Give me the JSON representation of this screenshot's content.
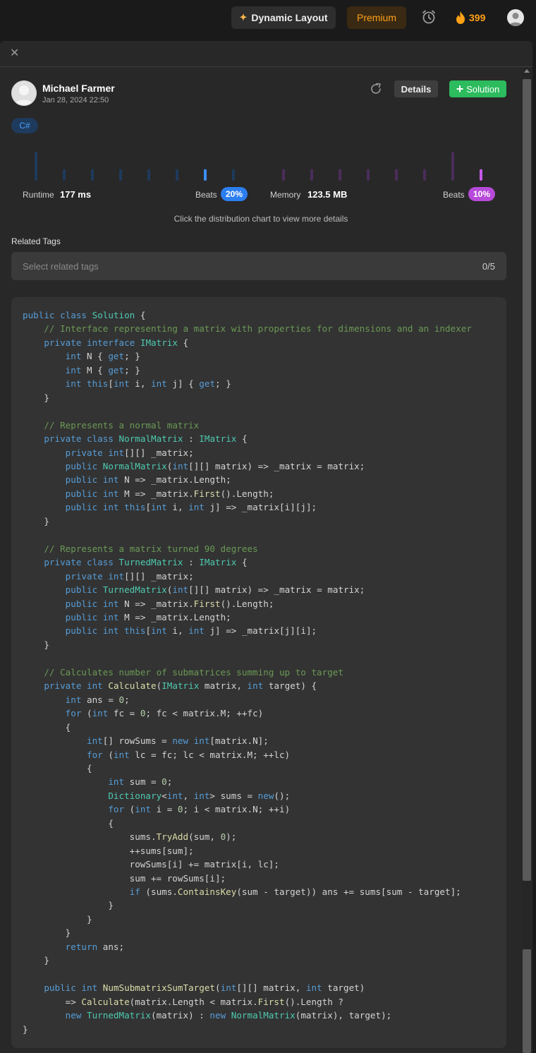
{
  "topbar": {
    "dynamic_layout_label": "Dynamic Layout",
    "premium_label": "Premium",
    "streak_count": "399",
    "icons": [
      "sparkle-icon",
      "alarm-clock-icon",
      "fire-icon",
      "user-avatar-icon"
    ]
  },
  "submission": {
    "author": "Michael Farmer",
    "date": "Jan 28, 2024 22:50",
    "details_label": "Details",
    "solution_label": "Solution",
    "language": "C#"
  },
  "stats": {
    "runtime_label": "Runtime",
    "runtime_value": "177 ms",
    "runtime_beats_label": "Beats",
    "runtime_beats": "20%",
    "memory_label": "Memory",
    "memory_value": "123.5 MB",
    "memory_beats_label": "Beats",
    "memory_beats": "10%",
    "hint": "Click the distribution chart to view more details",
    "runtime_distribution": [
      4.5,
      1.8,
      1.8,
      1.8,
      1.8,
      1.8,
      1.8,
      1.8
    ],
    "runtime_highlight_index": 6,
    "memory_distribution": [
      1.8,
      1.8,
      1.8,
      1.8,
      1.8,
      1.8,
      4.5,
      1.8
    ],
    "memory_highlight_index": 7,
    "colors": {
      "runtime_bar": "#1e3a5c",
      "runtime_active": "#3b8ef5",
      "memory_bar": "#4a2d5a",
      "memory_active": "#c659e8",
      "runtime_pill": "#2b7ef0",
      "memory_pill": "#b74ad9"
    }
  },
  "tags": {
    "title": "Related Tags",
    "placeholder": "Select related tags",
    "count": "0/5"
  },
  "code": {
    "language": "C#",
    "lines": [
      "public class Solution {",
      "    // Interface representing a matrix with properties for dimensions and an indexer",
      "    private interface IMatrix {",
      "        int N { get; }",
      "        int M { get; }",
      "        int this[int i, int j] { get; }",
      "    }",
      "",
      "    // Represents a normal matrix",
      "    private class NormalMatrix : IMatrix {",
      "        private int[][] _matrix;",
      "        public NormalMatrix(int[][] matrix) => _matrix = matrix;",
      "        public int N => _matrix.Length;",
      "        public int M => _matrix.First().Length;",
      "        public int this[int i, int j] => _matrix[i][j];",
      "    }",
      "",
      "    // Represents a matrix turned 90 degrees",
      "    private class TurnedMatrix : IMatrix {",
      "        private int[][] _matrix;",
      "        public TurnedMatrix(int[][] matrix) => _matrix = matrix;",
      "        public int N => _matrix.First().Length;",
      "        public int M => _matrix.Length;",
      "        public int this[int i, int j] => _matrix[j][i];",
      "    }",
      "",
      "    // Calculates number of submatrices summing up to target",
      "    private int Calculate(IMatrix matrix, int target) {",
      "        int ans = 0;",
      "        for (int fc = 0; fc < matrix.M; ++fc)",
      "        {",
      "            int[] rowSums = new int[matrix.N];",
      "            for (int lc = fc; lc < matrix.M; ++lc)",
      "            {",
      "                int sum = 0;",
      "                Dictionary<int, int> sums = new();",
      "                for (int i = 0; i < matrix.N; ++i)",
      "                {",
      "                    sums.TryAdd(sum, 0);",
      "                    ++sums[sum];",
      "                    rowSums[i] += matrix[i, lc];",
      "                    sum += rowSums[i];",
      "                    if (sums.ContainsKey(sum - target)) ans += sums[sum - target];",
      "                }",
      "            }",
      "        }",
      "        return ans;",
      "    }",
      "",
      "    public int NumSubmatrixSumTarget(int[][] matrix, int target)",
      "        => Calculate(matrix.Length < matrix.First().Length ?",
      "        new TurnedMatrix(matrix) : new NormalMatrix(matrix), target);",
      "}"
    ]
  }
}
